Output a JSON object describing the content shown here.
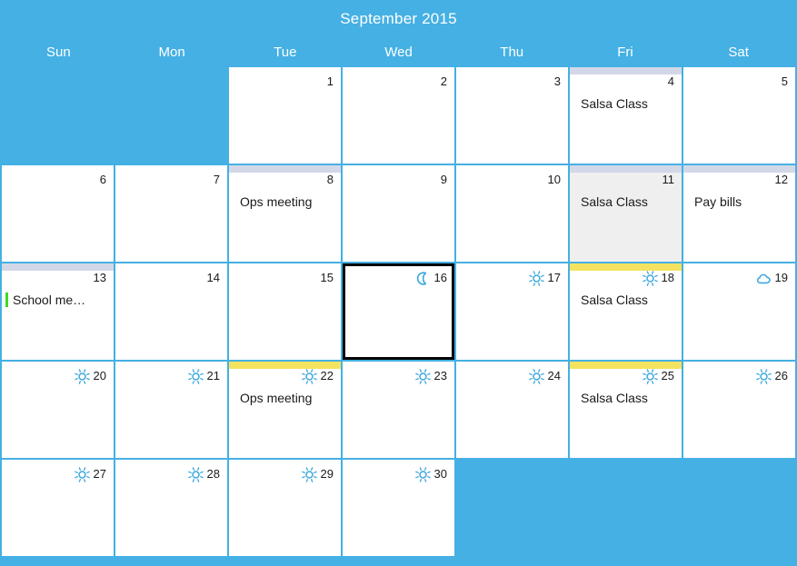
{
  "calendar": {
    "title": "September 2015",
    "weekdays": [
      "Sun",
      "Mon",
      "Tue",
      "Wed",
      "Thu",
      "Fri",
      "Sat"
    ],
    "colors": {
      "background": "#45b0e3",
      "cell": "#ffffff",
      "shaded_cell": "#efefef",
      "accent_lavender": "#d3d8e8",
      "accent_yellow": "#f4e361",
      "event_marker_green": "#3ddb23",
      "weather_icon": "#3ea8dd",
      "selection_outline": "#000000",
      "title_text": "#ffffff"
    },
    "weeks": [
      [
        {
          "day": "",
          "empty": true
        },
        {
          "day": "",
          "empty": true
        },
        {
          "day": "1",
          "weather": "",
          "top_bar": "",
          "shaded": false,
          "selected": false,
          "events": []
        },
        {
          "day": "2",
          "weather": "",
          "top_bar": "",
          "shaded": false,
          "selected": false,
          "events": []
        },
        {
          "day": "3",
          "weather": "",
          "top_bar": "",
          "shaded": false,
          "selected": false,
          "events": []
        },
        {
          "day": "4",
          "weather": "",
          "top_bar": "lavender",
          "shaded": false,
          "selected": false,
          "events": [
            {
              "title": "Salsa Class",
              "marker": ""
            }
          ]
        },
        {
          "day": "5",
          "weather": "",
          "top_bar": "",
          "shaded": false,
          "selected": false,
          "events": []
        }
      ],
      [
        {
          "day": "6",
          "weather": "",
          "top_bar": "",
          "shaded": false,
          "selected": false,
          "events": []
        },
        {
          "day": "7",
          "weather": "",
          "top_bar": "",
          "shaded": false,
          "selected": false,
          "events": []
        },
        {
          "day": "8",
          "weather": "",
          "top_bar": "lavender",
          "shaded": false,
          "selected": false,
          "events": [
            {
              "title": "Ops meeting",
              "marker": ""
            }
          ]
        },
        {
          "day": "9",
          "weather": "",
          "top_bar": "",
          "shaded": false,
          "selected": false,
          "events": []
        },
        {
          "day": "10",
          "weather": "",
          "top_bar": "",
          "shaded": false,
          "selected": false,
          "events": []
        },
        {
          "day": "11",
          "weather": "",
          "top_bar": "lavender",
          "shaded": true,
          "selected": false,
          "events": [
            {
              "title": "Salsa Class",
              "marker": ""
            }
          ]
        },
        {
          "day": "12",
          "weather": "",
          "top_bar": "lavender",
          "shaded": false,
          "selected": false,
          "events": [
            {
              "title": "Pay bills",
              "marker": ""
            }
          ]
        }
      ],
      [
        {
          "day": "13",
          "weather": "",
          "top_bar": "lavender",
          "shaded": false,
          "selected": false,
          "events": [
            {
              "title": "School me…",
              "marker": "green"
            }
          ]
        },
        {
          "day": "14",
          "weather": "",
          "top_bar": "",
          "shaded": false,
          "selected": false,
          "events": []
        },
        {
          "day": "15",
          "weather": "",
          "top_bar": "",
          "shaded": false,
          "selected": false,
          "events": []
        },
        {
          "day": "16",
          "weather": "moon",
          "top_bar": "",
          "shaded": false,
          "selected": true,
          "events": []
        },
        {
          "day": "17",
          "weather": "sun",
          "top_bar": "",
          "shaded": false,
          "selected": false,
          "events": []
        },
        {
          "day": "18",
          "weather": "sun",
          "top_bar": "yellow",
          "shaded": false,
          "selected": false,
          "events": [
            {
              "title": "Salsa Class",
              "marker": ""
            }
          ]
        },
        {
          "day": "19",
          "weather": "cloud",
          "top_bar": "",
          "shaded": false,
          "selected": false,
          "events": []
        }
      ],
      [
        {
          "day": "20",
          "weather": "sun",
          "top_bar": "",
          "shaded": false,
          "selected": false,
          "events": []
        },
        {
          "day": "21",
          "weather": "sun",
          "top_bar": "",
          "shaded": false,
          "selected": false,
          "events": []
        },
        {
          "day": "22",
          "weather": "sun",
          "top_bar": "yellow",
          "shaded": false,
          "selected": false,
          "events": [
            {
              "title": "Ops meeting",
              "marker": ""
            }
          ]
        },
        {
          "day": "23",
          "weather": "sun",
          "top_bar": "",
          "shaded": false,
          "selected": false,
          "events": []
        },
        {
          "day": "24",
          "weather": "sun",
          "top_bar": "",
          "shaded": false,
          "selected": false,
          "events": []
        },
        {
          "day": "25",
          "weather": "sun",
          "top_bar": "yellow",
          "shaded": false,
          "selected": false,
          "events": [
            {
              "title": "Salsa Class",
              "marker": ""
            }
          ]
        },
        {
          "day": "26",
          "weather": "sun",
          "top_bar": "",
          "shaded": false,
          "selected": false,
          "events": []
        }
      ],
      [
        {
          "day": "27",
          "weather": "sun",
          "top_bar": "",
          "shaded": false,
          "selected": false,
          "events": []
        },
        {
          "day": "28",
          "weather": "sun",
          "top_bar": "",
          "shaded": false,
          "selected": false,
          "events": []
        },
        {
          "day": "29",
          "weather": "sun",
          "top_bar": "",
          "shaded": false,
          "selected": false,
          "events": []
        },
        {
          "day": "30",
          "weather": "sun",
          "top_bar": "",
          "shaded": false,
          "selected": false,
          "events": []
        },
        {
          "day": "",
          "empty": true
        },
        {
          "day": "",
          "empty": true
        },
        {
          "day": "",
          "empty": true
        }
      ]
    ]
  }
}
